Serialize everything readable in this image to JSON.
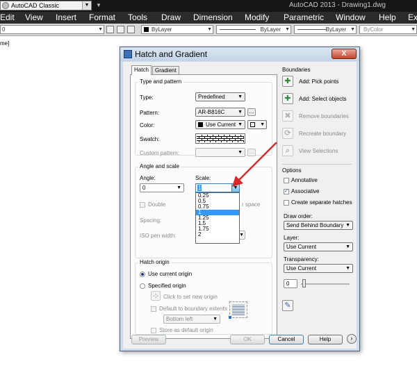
{
  "app": {
    "workspace": "AutoCAD Classic",
    "title": "AutoCAD 2013 - Drawing1.dwg"
  },
  "menu": [
    "Edit",
    "View",
    "Insert",
    "Format",
    "Tools",
    "Draw",
    "Dimension",
    "Modify",
    "Parametric",
    "Window",
    "Help",
    "Ex"
  ],
  "toolbar": {
    "layer_value": "0",
    "color": "ByLayer",
    "linetype": "ByLayer",
    "lineweight": "ByLayer",
    "plotstyle": "ByColor"
  },
  "cmd_fragment": "me]",
  "dialog": {
    "title": "Hatch and Gradient",
    "close": "X",
    "tabs": [
      "Hatch",
      "Gradient"
    ],
    "type_pattern": {
      "title": "Type and pattern",
      "type_label": "Type:",
      "type_value": "Predefined",
      "pattern_label": "Pattern:",
      "pattern_value": "AR-B816C",
      "color_label": "Color:",
      "color_value": "Use Current",
      "swatch_label": "Swatch:",
      "custom_label": "Custom pattern:",
      "dots": "..."
    },
    "angle_scale": {
      "title": "Angle and scale",
      "angle_label": "Angle:",
      "angle_value": "0",
      "scale_label": "Scale:",
      "scale_value": "1",
      "scale_options": [
        "0.25",
        "0.5",
        "0.75",
        "1",
        "1.25",
        "1.5",
        "1.75",
        "2"
      ],
      "selected_index": 3,
      "double_label": "Double",
      "relative_fragment": "r space",
      "spacing_label": "Spacing:",
      "iso_label": "ISO pen width:"
    },
    "origin": {
      "title": "Hatch origin",
      "use_current": "Use current origin",
      "specified": "Specified origin",
      "click_set": "Click to set new origin",
      "default_boundary": "Default to boundary extents",
      "bottom_left": "Bottom left",
      "store_default": "Store as default origin"
    },
    "boundaries": {
      "title": "Boundaries",
      "pick_points": "Add: Pick points",
      "select_objects": "Add: Select objects",
      "remove": "Remove boundaries",
      "recreate": "Recreate boundary",
      "view_selections": "View Selections"
    },
    "options": {
      "title": "Options",
      "annotative": "Annotative",
      "associative": "Associative",
      "separate": "Create separate hatches",
      "draw_order_label": "Draw order:",
      "draw_order_value": "Send Behind Boundary",
      "layer_label": "Layer:",
      "layer_value": "Use Current",
      "transparency_label": "Transparency:",
      "transparency_value": "Use Current",
      "transparency_amount": "0"
    },
    "inherit": "Inherit Properties",
    "buttons": {
      "preview": "Preview",
      "ok": "OK",
      "cancel": "Cancel",
      "help": "Help"
    }
  },
  "colors": {
    "annotation_arrow": "#d42a2a",
    "selection": "#3399ff"
  }
}
